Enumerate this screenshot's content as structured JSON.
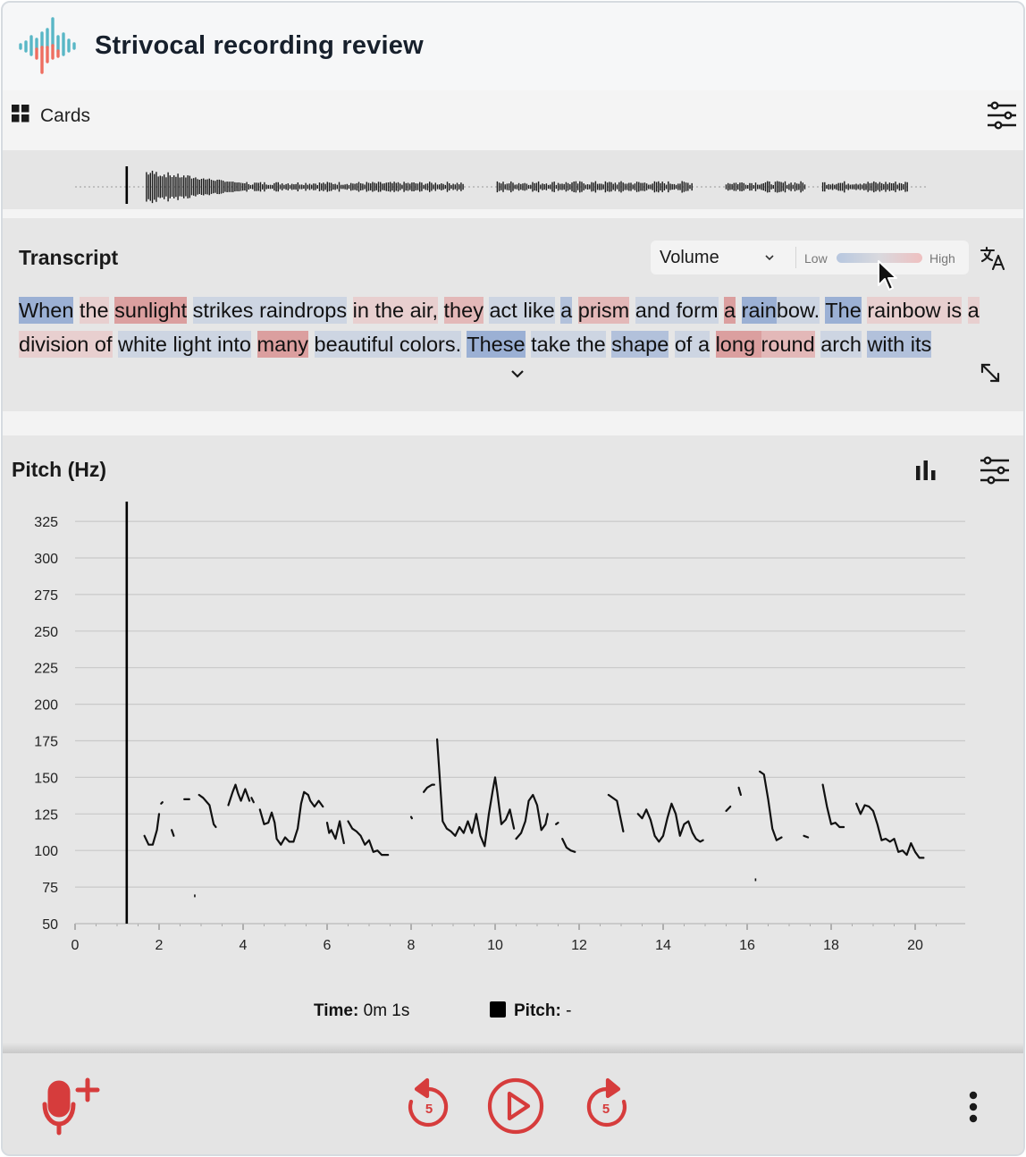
{
  "header": {
    "title": "Strivocal recording review"
  },
  "toolbar": {
    "view_label": "Cards"
  },
  "transcript": {
    "title": "Transcript",
    "metric_select": "Volume",
    "legend_low": "Low",
    "legend_high": "High",
    "words": [
      {
        "t": "When",
        "v": "lo3"
      },
      {
        "t": " ",
        "v": ""
      },
      {
        "t": "the",
        "v": "hi1"
      },
      {
        "t": " ",
        "v": ""
      },
      {
        "t": "sunlight",
        "v": "hi3"
      },
      {
        "t": " ",
        "v": ""
      },
      {
        "t": "strikes",
        "v": "lo1"
      },
      {
        "t": " ",
        "v": "lo1"
      },
      {
        "t": "raindrops",
        "v": "lo1"
      },
      {
        "t": " ",
        "v": ""
      },
      {
        "t": "in",
        "v": "hi1"
      },
      {
        "t": " ",
        "v": "hi1"
      },
      {
        "t": "the",
        "v": "hi1"
      },
      {
        "t": " ",
        "v": "hi1"
      },
      {
        "t": "air,",
        "v": "hi1"
      },
      {
        "t": " ",
        "v": ""
      },
      {
        "t": "they",
        "v": "hi2"
      },
      {
        "t": " ",
        "v": ""
      },
      {
        "t": "act",
        "v": "lo1"
      },
      {
        "t": " ",
        "v": "lo1"
      },
      {
        "t": "like",
        "v": "lo1"
      },
      {
        "t": " ",
        "v": ""
      },
      {
        "t": "a",
        "v": "lo2"
      },
      {
        "t": " ",
        "v": ""
      },
      {
        "t": "prism",
        "v": "hi2"
      },
      {
        "t": " ",
        "v": ""
      },
      {
        "t": "and",
        "v": "lo1"
      },
      {
        "t": " ",
        "v": "lo1"
      },
      {
        "t": "form",
        "v": "lo1"
      },
      {
        "t": " ",
        "v": ""
      },
      {
        "t": "a",
        "v": "hi3"
      },
      {
        "t": " ",
        "v": ""
      },
      {
        "t": "rain",
        "v": "lo3"
      },
      {
        "t": "bow.",
        "v": "lo1"
      },
      {
        "t": " ",
        "v": ""
      },
      {
        "t": "The",
        "v": "lo3"
      },
      {
        "t": " ",
        "v": ""
      },
      {
        "t": "rainbow",
        "v": "hi1"
      },
      {
        "t": " ",
        "v": "hi1"
      },
      {
        "t": "is",
        "v": "hi1"
      },
      {
        "t": " ",
        "v": ""
      },
      {
        "t": "a",
        "v": "hi1"
      },
      {
        "t": " ",
        "v": "hi1"
      },
      {
        "t": "division",
        "v": "hi1"
      },
      {
        "t": " ",
        "v": "hi1"
      },
      {
        "t": "of",
        "v": "hi1"
      },
      {
        "t": " ",
        "v": ""
      },
      {
        "t": "white",
        "v": "lo1"
      },
      {
        "t": " ",
        "v": "lo1"
      },
      {
        "t": "light",
        "v": "lo1"
      },
      {
        "t": " ",
        "v": "lo1"
      },
      {
        "t": "into",
        "v": "lo1"
      },
      {
        "t": " ",
        "v": ""
      },
      {
        "t": "many",
        "v": "hi3"
      },
      {
        "t": " ",
        "v": ""
      },
      {
        "t": "beautiful",
        "v": "lo1"
      },
      {
        "t": " ",
        "v": "lo1"
      },
      {
        "t": "colors.",
        "v": "lo1"
      },
      {
        "t": " ",
        "v": ""
      },
      {
        "t": "These",
        "v": "lo3"
      },
      {
        "t": " ",
        "v": ""
      },
      {
        "t": "take",
        "v": "lo1"
      },
      {
        "t": " ",
        "v": "lo1"
      },
      {
        "t": "the",
        "v": "lo1"
      },
      {
        "t": " ",
        "v": ""
      },
      {
        "t": "shape",
        "v": "lo2"
      },
      {
        "t": " ",
        "v": ""
      },
      {
        "t": "of",
        "v": "lo1"
      },
      {
        "t": " ",
        "v": "lo1"
      },
      {
        "t": "a",
        "v": "lo1"
      },
      {
        "t": " ",
        "v": ""
      },
      {
        "t": "long",
        "v": "hi3"
      },
      {
        "t": " ",
        "v": "hi3"
      },
      {
        "t": "round",
        "v": "hi2"
      },
      {
        "t": " ",
        "v": ""
      },
      {
        "t": "arch",
        "v": "lo1"
      },
      {
        "t": " ",
        "v": ""
      },
      {
        "t": "with",
        "v": "lo2"
      },
      {
        "t": " ",
        "v": "lo2"
      },
      {
        "t": "its",
        "v": "lo2"
      }
    ]
  },
  "pitch": {
    "title": "Pitch (Hz)",
    "time_label": "Time:",
    "time_value": "0m 1s",
    "pitch_label": "Pitch:",
    "pitch_value": "-"
  },
  "colors": {
    "accent_red": "#d63c3c",
    "low_blue": "#b7c7df",
    "high_red": "#efc0c0",
    "logo_teal": "#59b7c6",
    "logo_coral": "#ee6e60"
  },
  "chart_data": {
    "type": "line",
    "title": "Pitch (Hz)",
    "xlim": [
      0,
      21
    ],
    "ylim": [
      50,
      335
    ],
    "x_ticks": [
      0,
      2,
      4,
      6,
      8,
      10,
      12,
      14,
      16,
      18,
      20
    ],
    "y_ticks": [
      50,
      75,
      100,
      125,
      150,
      175,
      200,
      225,
      250,
      275,
      300,
      325
    ],
    "playhead_x": 1.23,
    "grid": true,
    "series": [
      {
        "segments": [
          [
            [
              1.65,
              110
            ],
            [
              1.75,
              104
            ],
            [
              1.85,
              104
            ],
            [
              1.95,
              114
            ],
            [
              2.0,
              125
            ]
          ],
          [
            [
              2.05,
              132
            ],
            [
              2.08,
              133
            ]
          ],
          [
            [
              2.3,
              114
            ],
            [
              2.35,
              110
            ]
          ],
          [
            [
              2.6,
              135
            ],
            [
              2.72,
              135
            ]
          ],
          [
            [
              2.95,
              138
            ],
            [
              3.05,
              136
            ],
            [
              3.2,
              131
            ],
            [
              3.3,
              118
            ],
            [
              3.35,
              116
            ]
          ],
          [
            [
              3.65,
              131
            ],
            [
              3.75,
              140
            ],
            [
              3.82,
              145
            ],
            [
              3.88,
              139
            ],
            [
              3.95,
              134
            ],
            [
              4.05,
              142
            ],
            [
              4.15,
              134
            ]
          ],
          [
            [
              4.2,
              136
            ],
            [
              4.25,
              133
            ]
          ],
          [
            [
              4.4,
              128
            ],
            [
              4.5,
              118
            ],
            [
              4.6,
              119
            ],
            [
              4.68,
              126
            ],
            [
              4.75,
              119
            ],
            [
              4.8,
              108
            ],
            [
              4.9,
              104
            ],
            [
              5.0,
              109
            ],
            [
              5.1,
              106
            ],
            [
              5.2,
              106
            ],
            [
              5.3,
              115
            ],
            [
              5.38,
              132
            ],
            [
              5.45,
              140
            ],
            [
              5.55,
              138
            ],
            [
              5.6,
              134
            ],
            [
              5.7,
              130
            ],
            [
              5.8,
              134
            ],
            [
              5.9,
              130
            ]
          ],
          [
            [
              6.0,
              119
            ],
            [
              6.05,
              112
            ],
            [
              6.1,
              114
            ],
            [
              6.2,
              108
            ],
            [
              6.3,
              120
            ],
            [
              6.35,
              112
            ],
            [
              6.4,
              105
            ]
          ],
          [
            [
              6.5,
              120
            ],
            [
              6.6,
              115
            ],
            [
              6.7,
              113
            ],
            [
              6.8,
              110
            ],
            [
              6.9,
              104
            ],
            [
              7.0,
              107
            ],
            [
              7.1,
              99
            ],
            [
              7.2,
              100
            ],
            [
              7.3,
              97
            ],
            [
              7.45,
              97
            ]
          ],
          [
            [
              8.0,
              123
            ],
            [
              8.02,
              122
            ]
          ],
          [
            [
              8.3,
              140
            ],
            [
              8.38,
              143
            ],
            [
              8.5,
              145
            ],
            [
              8.55,
              145
            ]
          ],
          [
            [
              8.62,
              176
            ],
            [
              8.68,
              150
            ],
            [
              8.75,
              120
            ],
            [
              8.85,
              115
            ],
            [
              8.95,
              113
            ],
            [
              9.05,
              110
            ],
            [
              9.15,
              116
            ],
            [
              9.25,
              112
            ],
            [
              9.35,
              120
            ],
            [
              9.45,
              112
            ],
            [
              9.55,
              125
            ],
            [
              9.65,
              110
            ],
            [
              9.75,
              103
            ],
            [
              9.85,
              125
            ],
            [
              9.95,
              142
            ],
            [
              10.0,
              150
            ],
            [
              10.05,
              140
            ],
            [
              10.15,
              118
            ],
            [
              10.25,
              121
            ],
            [
              10.35,
              128
            ],
            [
              10.45,
              115
            ]
          ],
          [
            [
              10.5,
              108
            ],
            [
              10.62,
              112
            ],
            [
              10.72,
              120
            ],
            [
              10.8,
              134
            ],
            [
              10.9,
              138
            ],
            [
              11.0,
              131
            ],
            [
              11.1,
              114
            ],
            [
              11.2,
              118
            ],
            [
              11.25,
              125
            ]
          ],
          [
            [
              11.45,
              118
            ],
            [
              11.5,
              119
            ]
          ],
          [
            [
              11.6,
              108
            ],
            [
              11.7,
              102
            ],
            [
              11.8,
              100
            ],
            [
              11.9,
              99
            ]
          ],
          [
            [
              12.7,
              138
            ],
            [
              12.9,
              134
            ],
            [
              13.05,
              113
            ]
          ],
          [
            [
              13.4,
              125
            ],
            [
              13.5,
              122
            ],
            [
              13.6,
              128
            ],
            [
              13.7,
              121
            ],
            [
              13.8,
              110
            ],
            [
              13.9,
              106
            ],
            [
              14.0,
              110
            ],
            [
              14.1,
              122
            ],
            [
              14.2,
              132
            ],
            [
              14.3,
              125
            ],
            [
              14.4,
              110
            ],
            [
              14.5,
              118
            ],
            [
              14.6,
              120
            ],
            [
              14.7,
              112
            ],
            [
              14.78,
              108
            ],
            [
              14.88,
              106
            ],
            [
              14.95,
              107
            ]
          ],
          [
            [
              15.5,
              127
            ],
            [
              15.6,
              130
            ]
          ],
          [
            [
              15.8,
              143
            ],
            [
              15.85,
              138
            ]
          ],
          [
            [
              16.3,
              154
            ],
            [
              16.4,
              152
            ],
            [
              16.5,
              135
            ],
            [
              16.6,
              115
            ],
            [
              16.7,
              107
            ],
            [
              16.82,
              109
            ]
          ],
          [
            [
              17.35,
              110
            ],
            [
              17.45,
              109
            ]
          ],
          [
            [
              17.8,
              145
            ],
            [
              17.9,
              130
            ],
            [
              18.0,
              118
            ],
            [
              18.1,
              119
            ],
            [
              18.2,
              116
            ],
            [
              18.3,
              116
            ]
          ],
          [
            [
              18.6,
              132
            ],
            [
              18.7,
              125
            ],
            [
              18.8,
              131
            ],
            [
              18.9,
              130
            ],
            [
              19.0,
              127
            ],
            [
              19.1,
              118
            ],
            [
              19.2,
              107
            ],
            [
              19.3,
              108
            ],
            [
              19.4,
              106
            ],
            [
              19.5,
              108
            ],
            [
              19.6,
              99
            ],
            [
              19.7,
              100
            ],
            [
              19.8,
              97
            ],
            [
              19.9,
              105
            ],
            [
              20.0,
              99
            ],
            [
              20.1,
              95
            ],
            [
              20.2,
              95
            ]
          ]
        ],
        "dots": [
          [
            2.85,
            69
          ],
          [
            16.2,
            80
          ]
        ]
      }
    ]
  },
  "waveform": {
    "segments": [
      {
        "from": 1.7,
        "to": 9.25,
        "amp": 0.32
      },
      {
        "from": 10.05,
        "to": 14.7,
        "amp": 0.38
      },
      {
        "from": 15.5,
        "to": 17.4,
        "amp": 0.38
      },
      {
        "from": 17.8,
        "to": 19.85,
        "amp": 0.38
      }
    ]
  }
}
